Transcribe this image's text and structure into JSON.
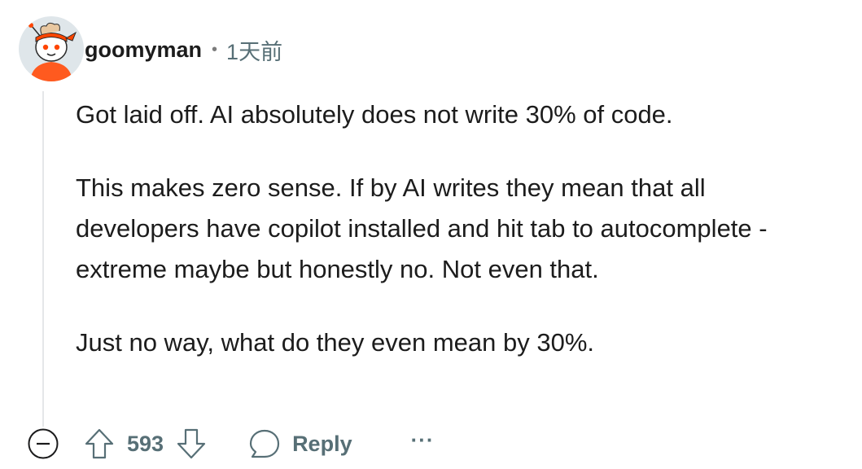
{
  "comment": {
    "author": "goomyman",
    "separator": "•",
    "timestamp": "1天前",
    "paragraphs": [
      "Got laid off. AI absolutely does not write 30% of code.",
      "This makes zero sense. If by AI writes they mean that all developers have copilot installed and hit tab to autocomplete - extreme maybe but honestly no. Not even that.",
      "Just no way, what do they even mean by 30%."
    ],
    "score": "593",
    "reply_label": "Reply",
    "more_label": "···"
  },
  "icons": {
    "avatar": "avatar-icon",
    "collapse": "collapse-minus-icon",
    "upvote": "upvote-arrow-icon",
    "downvote": "downvote-arrow-icon",
    "reply": "speech-bubble-icon",
    "more": "ellipsis-icon"
  },
  "colors": {
    "username": "#1c1c1c",
    "meta": "#576f76",
    "thread_line": "#e5e7e9",
    "avatar_bg": "#dfe6ea",
    "avatar_accent": "#ff4500"
  }
}
